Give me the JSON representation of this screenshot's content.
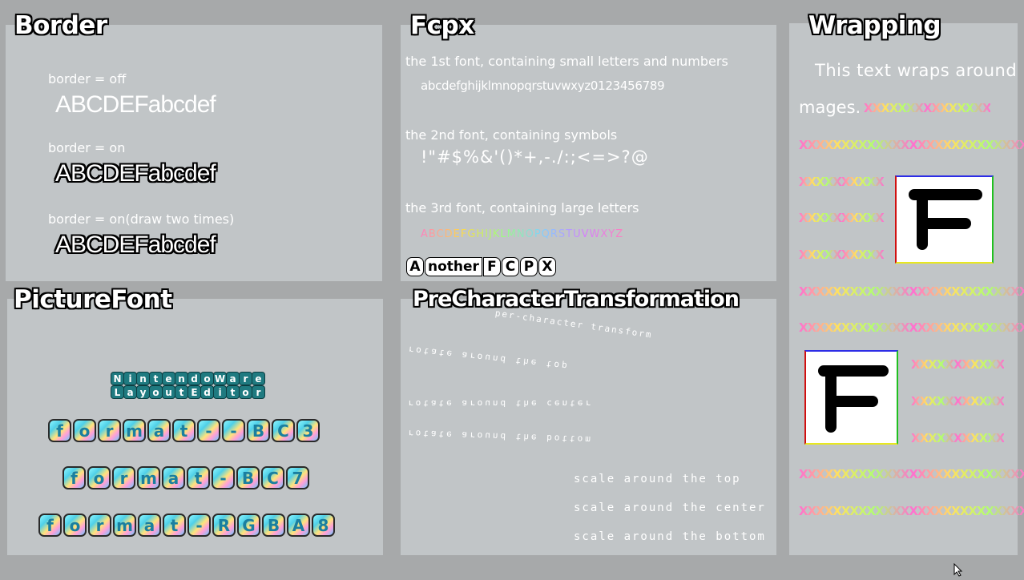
{
  "panels": {
    "border": {
      "title": "Border",
      "items": [
        {
          "label": "border = off",
          "sample": "ABCDEFabcdef"
        },
        {
          "label": "border = on",
          "sample": "ABCDEFabcdef"
        },
        {
          "label": "border = on(draw two times)",
          "sample": "ABCDEFabcdef"
        }
      ]
    },
    "fcpx": {
      "title": "Fcpx",
      "font1_label": "the 1st font, containing small letters and numbers",
      "font1_sample": "abcdefghijklmnopqrstuvwxyz0123456789",
      "font2_label": "the 2nd font, containing symbols",
      "font2_sample": "!\"#$%&'()*+,-./:;<=>?@",
      "font3_label": "the 3rd font, containing large letters",
      "font3_sample": "ABCDEFGHIJKLMNOPQRSTUVWXYZ",
      "another": [
        "A",
        "nother",
        "F",
        "C",
        "P",
        "X"
      ]
    },
    "wrapping": {
      "title": "Wrapping",
      "line1": "This text wraps around i",
      "line2": "mages.",
      "x_fill_short": "XXXXXXXXXXXXXXX",
      "x_fill_long": "XXXXXXXXXXXXXXXXXXXXXXXXXXX",
      "x_fill_left": "XXXXXXXXXX",
      "x_fill_right": "XXXXXXXXXXX",
      "image_letter": "F"
    },
    "picture_font": {
      "title": "PictureFont",
      "teal_line1": "NintendoWare",
      "teal_line2": "LayoutEditor",
      "chips_bc3": [
        "f",
        "o",
        "r",
        "m",
        "a",
        "t",
        "-",
        "-",
        "B",
        "C",
        "3"
      ],
      "chips_bc7": [
        "f",
        "o",
        "r",
        "m",
        "a",
        "t",
        "-",
        "B",
        "C",
        "7"
      ],
      "chips_rgba8": [
        "f",
        "o",
        "r",
        "m",
        "a",
        "t",
        "-",
        "R",
        "G",
        "B",
        "A",
        "8"
      ]
    },
    "pre_char": {
      "title": "PreCharacterTransformation",
      "rot_top": "rotate around the top",
      "rot_center": "rotate around the center",
      "rot_bottom": "rotate around the bottom",
      "scale_top": "scale around the top",
      "scale_center": "scale around the center",
      "scale_bottom": "scale around the bottom",
      "wave_text": "per-character transform"
    }
  },
  "colors": {
    "background": "#a7a9aa",
    "panel": "#c1c5c7",
    "title_fill": "#ffffff",
    "title_outline": "#000000",
    "teal": "#1f7a80"
  },
  "icons": [
    "mouse-cursor-icon"
  ]
}
